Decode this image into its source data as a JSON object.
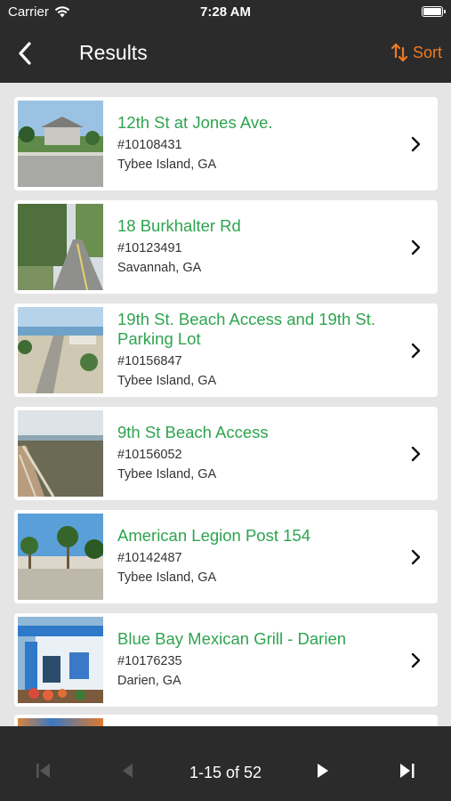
{
  "status": {
    "carrier": "Carrier",
    "time": "7:28 AM"
  },
  "nav": {
    "title": "Results",
    "sort_label": "Sort",
    "accent": "#f07a21"
  },
  "results": [
    {
      "name": "12th St at Jones Ave.",
      "id": "#10108431",
      "location": "Tybee Island, GA"
    },
    {
      "name": "18 Burkhalter Rd",
      "id": "#10123491",
      "location": "Savannah, GA"
    },
    {
      "name": "19th St. Beach Access and 19th St. Parking Lot",
      "id": "#10156847",
      "location": "Tybee Island, GA"
    },
    {
      "name": "9th St Beach Access",
      "id": "#10156052",
      "location": "Tybee Island, GA"
    },
    {
      "name": "American Legion Post 154",
      "id": "#10142487",
      "location": "Tybee Island, GA"
    },
    {
      "name": "Blue Bay Mexican Grill - Darien",
      "id": "#10176235",
      "location": "Darien, GA"
    }
  ],
  "pager": {
    "label": "1-15 of 52"
  },
  "colors": {
    "title_green": "#2ea44f",
    "list_bg": "#e5e5e5",
    "dark_bg": "#2b2b2b"
  },
  "icons": [
    "wifi-icon",
    "battery-icon",
    "back-chevron-icon",
    "sort-arrows-icon",
    "chevron-right-icon",
    "first-page-icon",
    "previous-page-icon",
    "next-page-icon",
    "last-page-icon"
  ]
}
